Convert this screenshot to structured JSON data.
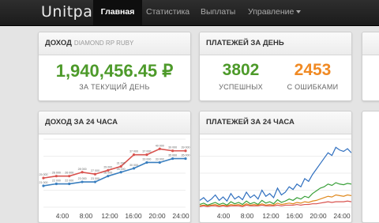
{
  "brand": {
    "logo": "Unitpay"
  },
  "nav": {
    "items": [
      {
        "label": "Главная",
        "active": true
      },
      {
        "label": "Статистика"
      },
      {
        "label": "Выплаты"
      },
      {
        "label": "Управление"
      }
    ]
  },
  "income": {
    "title": "ДОХОД",
    "project": "DIAMOND RP RUBY",
    "amount": "1,940,456.45 ₽",
    "caption": "ЗА ТЕКУЩИЙ ДЕНЬ"
  },
  "payments": {
    "title": "ПЛАТЕЖЕЙ ЗА ДЕНЬ",
    "success_count": "3802",
    "success_label": "УСПЕШНЫХ",
    "error_count": "2453",
    "error_label": "С ОШИБКАМИ"
  },
  "colors": {
    "green": "#4d9a2a",
    "orange": "#f08a24",
    "red": "#d9534f",
    "blue": "#3a7fbf"
  },
  "chart_data": [
    {
      "type": "line",
      "title": "ДОХОД ЗА 24 ЧАСА",
      "x": [
        "4:00",
        "8:00",
        "12:00",
        "16:00",
        "20:00",
        "24:00"
      ],
      "ylim": [
        10000,
        45000
      ],
      "series": [
        {
          "color": "#d9534f",
          "points": [
            [
              1,
              25000
            ],
            [
              2,
              26000
            ],
            [
              3,
              26000
            ],
            [
              4,
              28000
            ],
            [
              5,
              27000
            ],
            [
              6,
              29000
            ],
            [
              7,
              31000
            ],
            [
              8,
              37000
            ],
            [
              9,
              37000
            ],
            [
              10,
              40000
            ],
            [
              11,
              39000
            ],
            [
              12,
              39000
            ]
          ],
          "labels": [
            "25 000",
            "26 000",
            "26 000",
            "28 000",
            "27 000",
            "29 000",
            "31 000",
            "37 000",
            "37 000",
            "40 000",
            "39 000",
            "39 000"
          ]
        },
        {
          "color": "#3a7fbf",
          "points": [
            [
              1,
              21000
            ],
            [
              2,
              22000
            ],
            [
              3,
              22000
            ],
            [
              4,
              23000
            ],
            [
              5,
              23000
            ],
            [
              6,
              26000
            ],
            [
              7,
              28000
            ],
            [
              8,
              30000
            ],
            [
              9,
              33000
            ],
            [
              10,
              33000
            ],
            [
              11,
              35000
            ],
            [
              12,
              35000
            ]
          ],
          "labels": [
            "21 000",
            "22 000",
            "22 000",
            "23 000",
            "23 000",
            "26 000",
            "28 000",
            "30 000",
            "33 000",
            "33 000",
            "35 000",
            "35 000"
          ]
        }
      ]
    },
    {
      "type": "line",
      "title": "ПЛАТЕЖЕЙ ЗА 24 ЧАСА",
      "x": [
        "4:00",
        "8:00",
        "12:00",
        "16:00",
        "20:00",
        "24:00"
      ],
      "ylim": [
        0,
        100
      ],
      "series": [
        {
          "color": "#2f6fbf",
          "values": [
            10,
            14,
            8,
            12,
            18,
            10,
            15,
            9,
            20,
            12,
            16,
            11,
            22,
            14,
            18,
            12,
            25,
            16,
            20,
            14,
            28,
            18,
            22,
            30,
            26,
            34,
            30,
            42,
            38,
            48,
            56,
            64,
            72,
            80,
            76,
            88,
            84,
            82,
            86,
            80
          ]
        },
        {
          "color": "#3aa03a",
          "values": [
            4,
            6,
            3,
            5,
            7,
            4,
            6,
            3,
            8,
            5,
            7,
            4,
            9,
            5,
            7,
            4,
            10,
            6,
            8,
            5,
            11,
            7,
            9,
            12,
            10,
            14,
            12,
            16,
            14,
            20,
            24,
            28,
            30,
            34,
            32,
            36,
            34,
            33,
            35,
            34
          ]
        },
        {
          "color": "#e08a1e",
          "values": [
            2,
            3,
            2,
            3,
            4,
            2,
            3,
            2,
            4,
            3,
            4,
            2,
            5,
            3,
            4,
            3,
            5,
            3,
            4,
            3,
            6,
            4,
            5,
            6,
            5,
            7,
            6,
            8,
            7,
            9,
            10,
            12,
            14,
            16,
            15,
            18,
            17,
            16,
            18,
            17
          ]
        },
        {
          "color": "#d9534f",
          "values": [
            1,
            2,
            1,
            2,
            2,
            1,
            2,
            1,
            2,
            2,
            2,
            1,
            3,
            2,
            2,
            2,
            3,
            2,
            2,
            2,
            3,
            2,
            3,
            3,
            3,
            4,
            3,
            4,
            4,
            5,
            5,
            6,
            7,
            8,
            7,
            8,
            8,
            8,
            9,
            8
          ]
        }
      ]
    }
  ]
}
